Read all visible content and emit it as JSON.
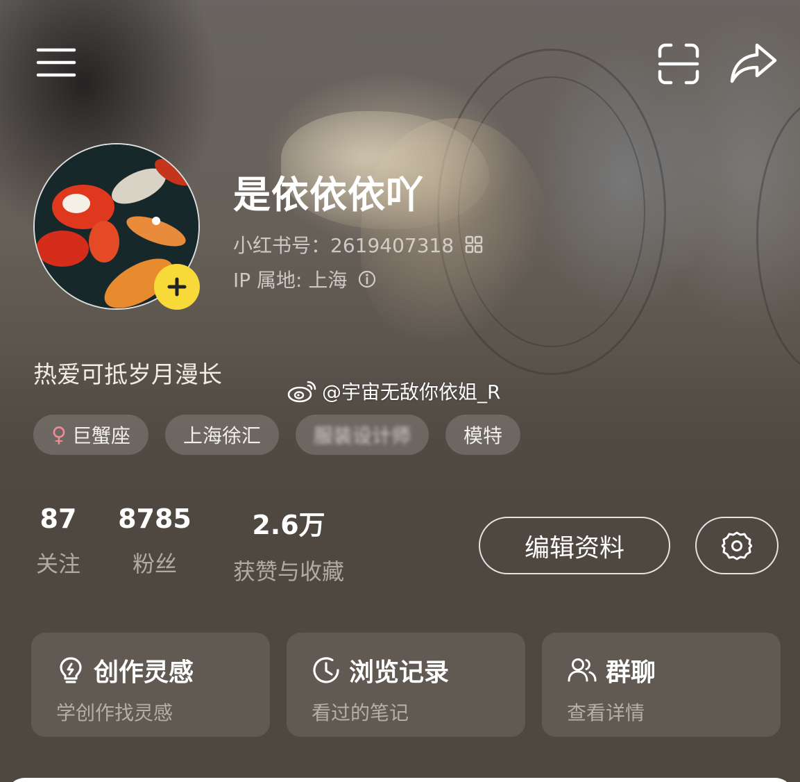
{
  "profile": {
    "username": "是依依依吖",
    "id_label": "小红书号：2619407318",
    "ip_label": "IP 属地: 上海",
    "bio": "热爱可抵岁月漫长"
  },
  "watermark": {
    "text": "@宇宙无敌你依姐_R"
  },
  "tags": [
    {
      "label": "巨蟹座",
      "icon": "female-icon"
    },
    {
      "label": "上海徐汇"
    },
    {
      "label": "服装设计师"
    },
    {
      "label": "模特"
    }
  ],
  "stats": {
    "following": {
      "value": "87",
      "label": "关注"
    },
    "fans": {
      "value": "8785",
      "label": "粉丝"
    },
    "likes": {
      "value": "2.6万",
      "label": "获赞与收藏"
    }
  },
  "actions": {
    "edit_label": "编辑资料"
  },
  "cards": [
    {
      "title": "创作灵感",
      "subtitle": "学创作找灵感",
      "icon": "lightbulb-icon"
    },
    {
      "title": "浏览记录",
      "subtitle": "看过的笔记",
      "icon": "clock-icon"
    },
    {
      "title": "群聊",
      "subtitle": "查看详情",
      "icon": "group-icon"
    }
  ],
  "colors": {
    "background": "#4e4840",
    "add_button": "#f7d93a",
    "female_icon": "#f08a95"
  }
}
